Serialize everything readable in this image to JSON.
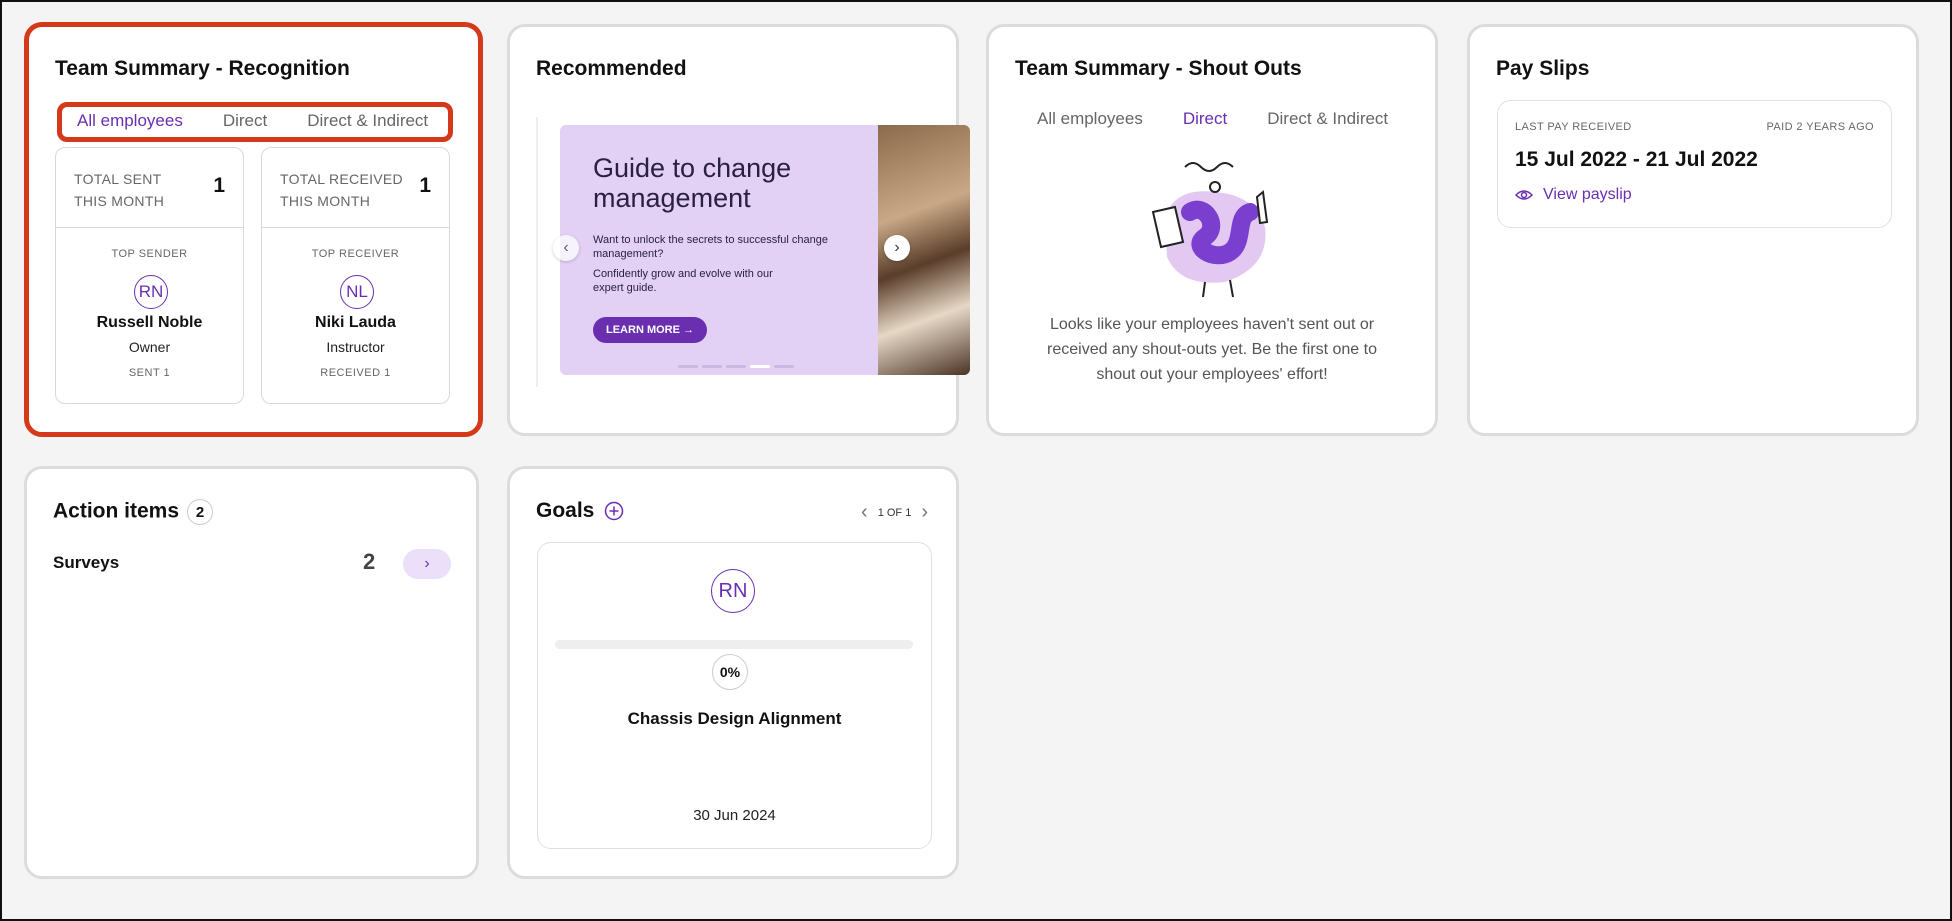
{
  "recognition": {
    "title": "Team Summary - Recognition",
    "tabs": [
      "All employees",
      "Direct",
      "Direct & Indirect"
    ],
    "active_tab": "All employees",
    "sent": {
      "label": "TOTAL SENT THIS MONTH",
      "value": "1",
      "top_label": "TOP SENDER",
      "initials": "RN",
      "name": "Russell Noble",
      "role": "Owner",
      "count_label": "SENT 1"
    },
    "received": {
      "label": "TOTAL RECEIVED THIS MONTH",
      "value": "1",
      "top_label": "TOP RECEIVER",
      "initials": "NL",
      "name": "Niki Lauda",
      "role": "Instructor",
      "count_label": "RECEIVED 1"
    }
  },
  "recommended": {
    "title": "Recommended",
    "banner_heading": "Guide to change management",
    "banner_text_1": "Want to unlock the secrets to successful change management?",
    "banner_text_2": "Confidently grow and evolve with our expert guide.",
    "cta_label": "LEARN MORE →",
    "active_dot": 4,
    "dot_count": 5
  },
  "shoutouts": {
    "title": "Team Summary - Shout Outs",
    "tabs": [
      "All employees",
      "Direct",
      "Direct & Indirect"
    ],
    "active_tab": "Direct",
    "empty_message": "Looks like your employees haven't sent out or received any shout-outs yet. Be the first one to shout out your employees' effort!"
  },
  "payslips": {
    "title": "Pay Slips",
    "last_label": "LAST PAY RECEIVED",
    "ago_label": "PAID 2 YEARS AGO",
    "period": "15 Jul 2022 - 21 Jul 2022",
    "view_label": "View payslip"
  },
  "action_items": {
    "title": "Action items",
    "count": "2",
    "rows": [
      {
        "label": "Surveys",
        "count": "2"
      }
    ]
  },
  "goals": {
    "title": "Goals",
    "pager": "1 OF 1",
    "initials": "RN",
    "progress_percent": 0,
    "progress_label": "0%",
    "goal_name": "Chassis Design Alignment",
    "due_date": "30 Jun 2024"
  },
  "colors": {
    "accent": "#6a2fb0",
    "highlight": "#d43a1a",
    "banner": "#e2d0f5"
  }
}
